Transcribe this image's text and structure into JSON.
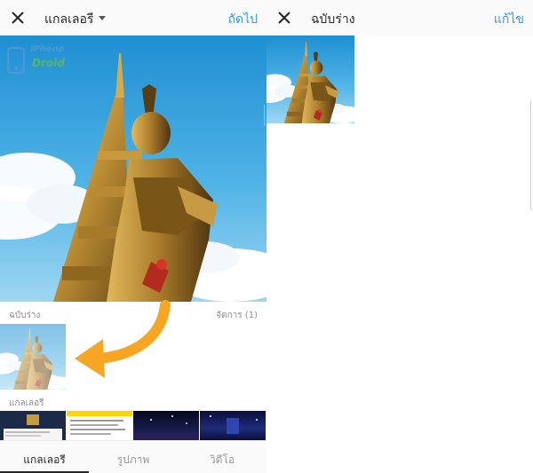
{
  "left_panel": {
    "header": {
      "title": "แกลเลอรี",
      "next_label": "ถัดไป"
    },
    "watermark": {
      "line1": "iPhone",
      "line2": "Droid"
    },
    "drafts": {
      "label": "ฉบับร่าง",
      "manage_label": "จัดการ (1)"
    },
    "gallery": {
      "label": "แกลเลอรี"
    },
    "tabs": [
      {
        "label": "แกลเลอรี",
        "active": true
      },
      {
        "label": "รูปภาพ",
        "active": false
      },
      {
        "label": "วิดีโอ",
        "active": false
      }
    ]
  },
  "right_panel": {
    "header": {
      "title": "ฉบับร่าง",
      "edit_label": "แก้ไข"
    }
  },
  "colors": {
    "accent": "#3897f0",
    "arrow": "#f6a623",
    "header_bg": "#fafafa",
    "muted_text": "#8e8e8e"
  },
  "icons": [
    "close-icon",
    "caret-down-icon",
    "curved-arrow-icon"
  ]
}
